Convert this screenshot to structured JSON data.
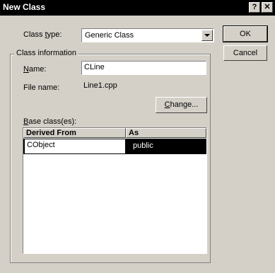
{
  "window": {
    "title": "New Class",
    "help_btn": "?",
    "close_btn": "✕"
  },
  "class_type": {
    "label_pre": "Class ",
    "label_key": "t",
    "label_post": "ype:",
    "value": "Generic Class"
  },
  "buttons": {
    "ok": "OK",
    "cancel": "Cancel",
    "change_key": "C",
    "change_post": "hange..."
  },
  "class_info": {
    "group_title": "Class information",
    "name_key": "N",
    "name_post": "ame:",
    "name_value": "CLine",
    "file_label": "File name:",
    "file_value": "Line1.cpp"
  },
  "base_classes": {
    "label_key": "B",
    "label_post": "ase class(es):",
    "columns": [
      "Derived From",
      "As"
    ],
    "rows": [
      {
        "derived_from": "CObject",
        "as": "public"
      }
    ]
  }
}
